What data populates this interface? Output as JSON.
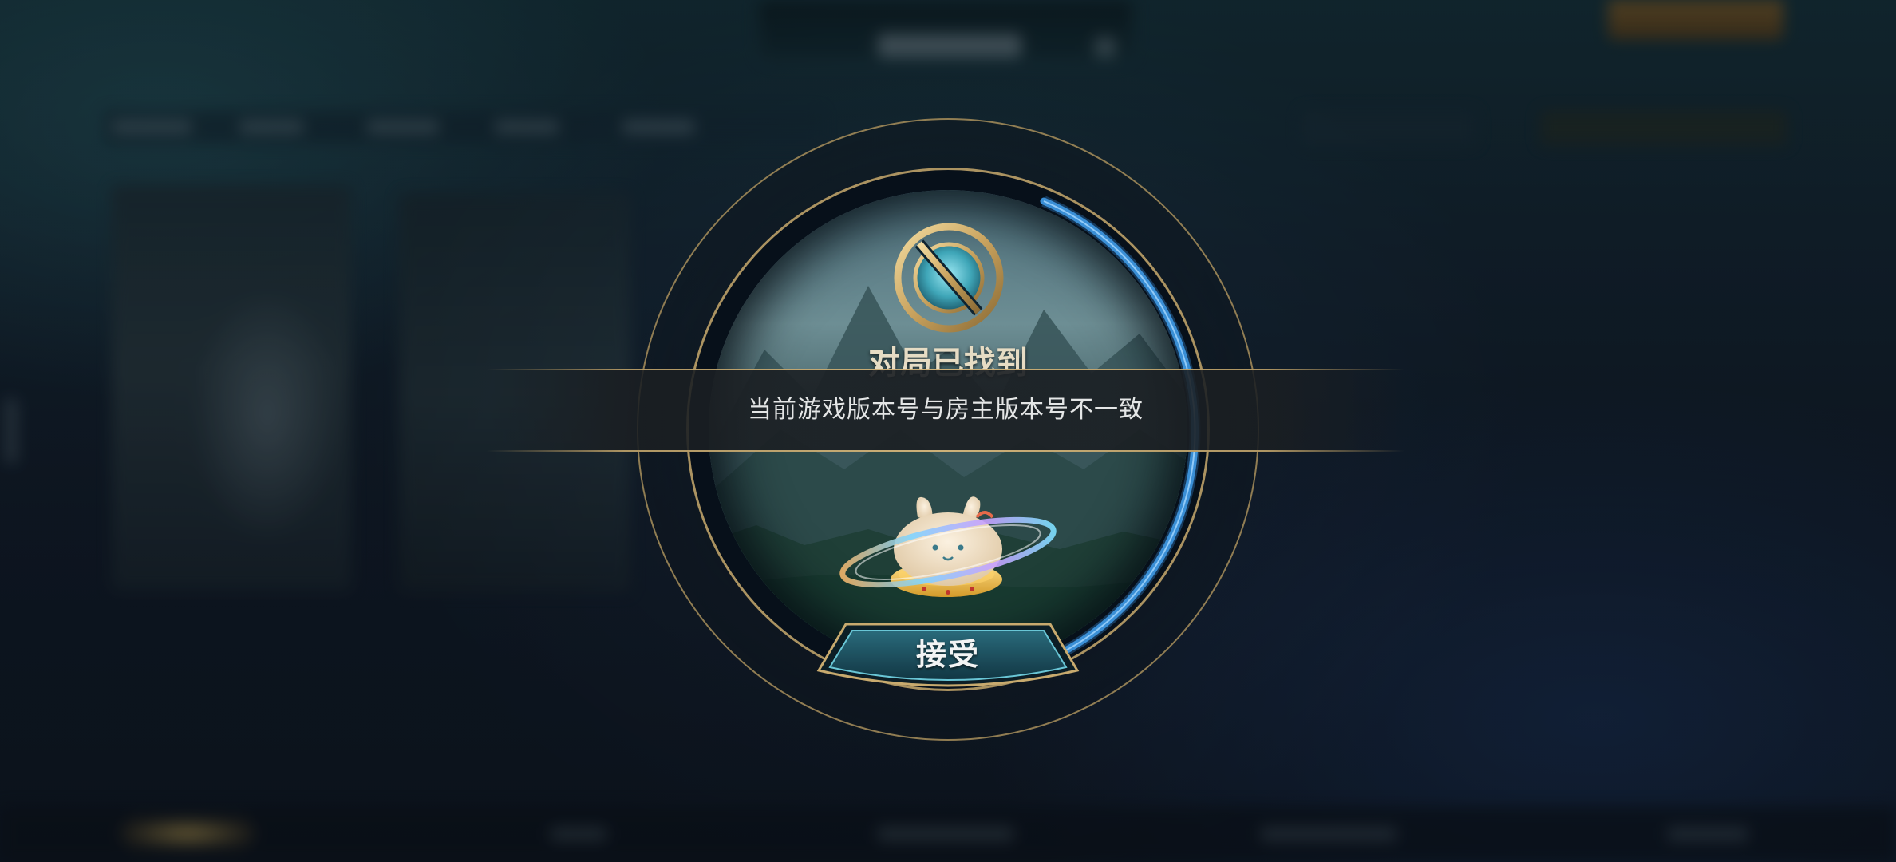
{
  "match_dialog": {
    "title": "对局已找到",
    "accept_label": "接受",
    "icon": "match-found-emblem-icon",
    "mascot": "mascot-rabbit-ring-icon"
  },
  "toast": {
    "message": "当前游戏版本号与房主版本号不一致"
  },
  "colors": {
    "gold_accent": "#c8aa6e",
    "timer_blue": "#3a8fd6",
    "accept_teal": "#1f5c6b"
  }
}
